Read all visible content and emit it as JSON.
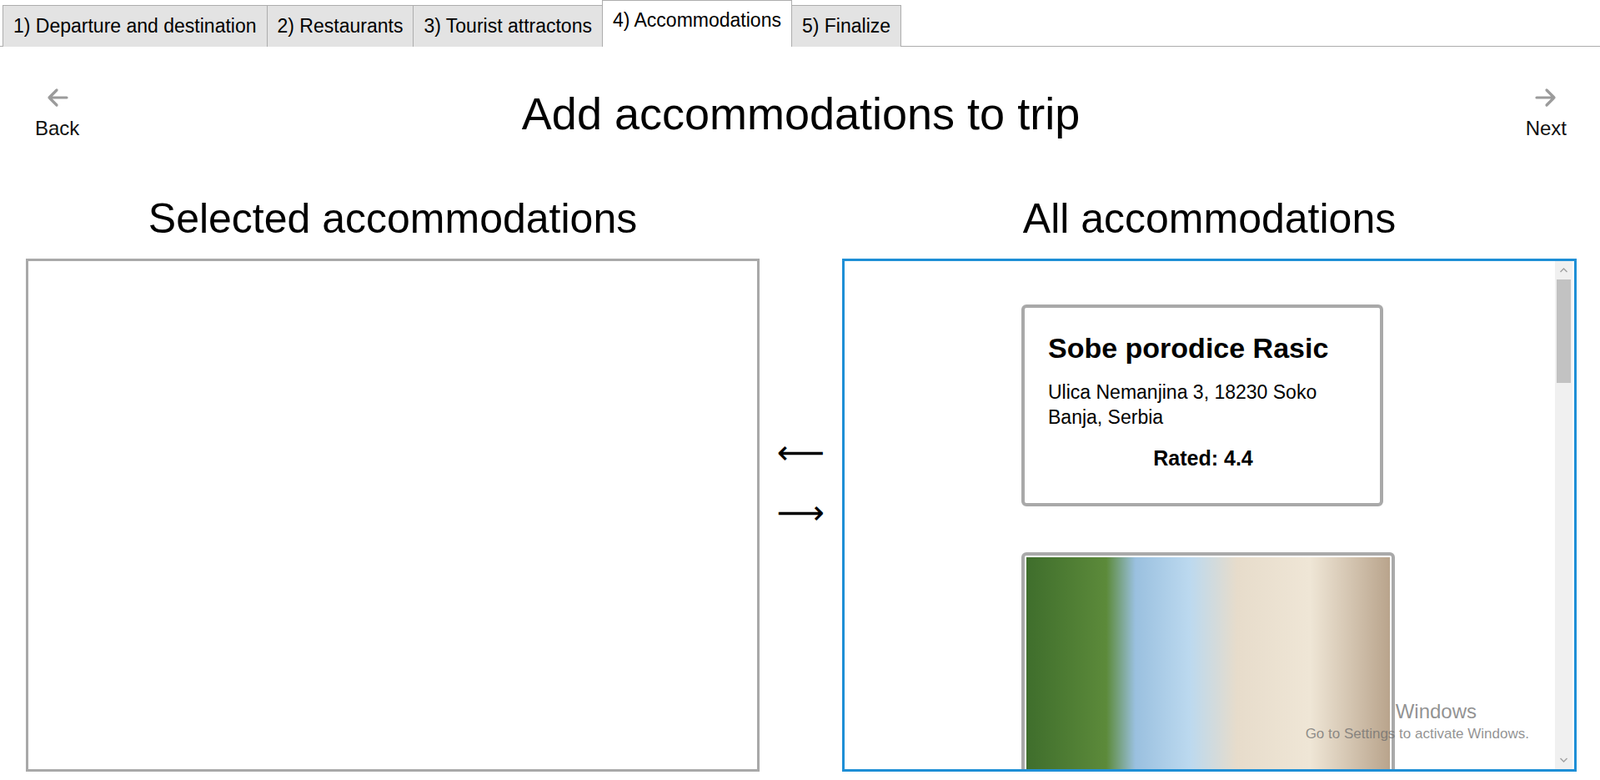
{
  "tabs": [
    {
      "label": "1) Departure and destination",
      "selected": false
    },
    {
      "label": "2) Restaurants",
      "selected": false
    },
    {
      "label": "3) Tourist attractons",
      "selected": false
    },
    {
      "label": "4) Accommodations",
      "selected": true
    },
    {
      "label": "5) Finalize",
      "selected": false
    }
  ],
  "header": {
    "title": "Add accommodations to trip",
    "back": "Back",
    "next": "Next"
  },
  "selected_panel": {
    "heading": "Selected accommodations",
    "focused": false,
    "items": []
  },
  "move_buttons": [
    "⟵",
    "⟶"
  ],
  "all_panel": {
    "heading": "All accommodations",
    "focused": true,
    "items": [
      {
        "kind": "info",
        "name": "Sobe porodice Rasic",
        "address": "Ulica Nemanjina 3, 18230 Soko Banja, Serbia",
        "rating": "Rated: 4.4"
      },
      {
        "kind": "photo"
      }
    ],
    "scrollbar": {
      "level": 0.22
    }
  },
  "watermark": {
    "title": "Windows",
    "subtitle": "Go to Settings to activate Windows."
  }
}
